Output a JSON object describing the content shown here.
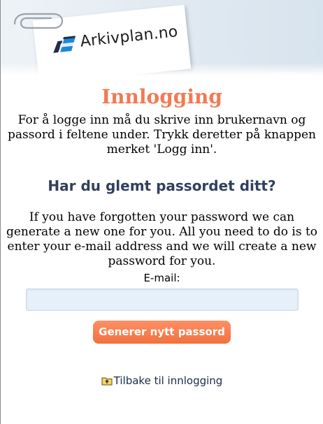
{
  "brand": {
    "logo_text": "Arkivplan.no",
    "icon": "arkivplan-logo-icon"
  },
  "page": {
    "title": "Innlogging",
    "intro": "For å logge inn må du skrive inn brukernavn og passord i feltene under. Trykk deretter på knappen merket 'Logg inn'."
  },
  "reset": {
    "heading": "Har du glemt passordet ditt?",
    "description": "If you have forgotten your password we can generate a new one for you. All you need to do is to enter your e-mail address and we will create a new password for you.",
    "email_label": "E-mail:",
    "email_value": "",
    "submit_label": "Generer nytt passord"
  },
  "nav": {
    "back_label": "Tilbake til innlogging",
    "back_icon": "folder-up-icon"
  },
  "colors": {
    "title": "#f27a52",
    "heading": "#30405e",
    "button": "#f2703f",
    "input_bg": "#e6f0fa"
  }
}
